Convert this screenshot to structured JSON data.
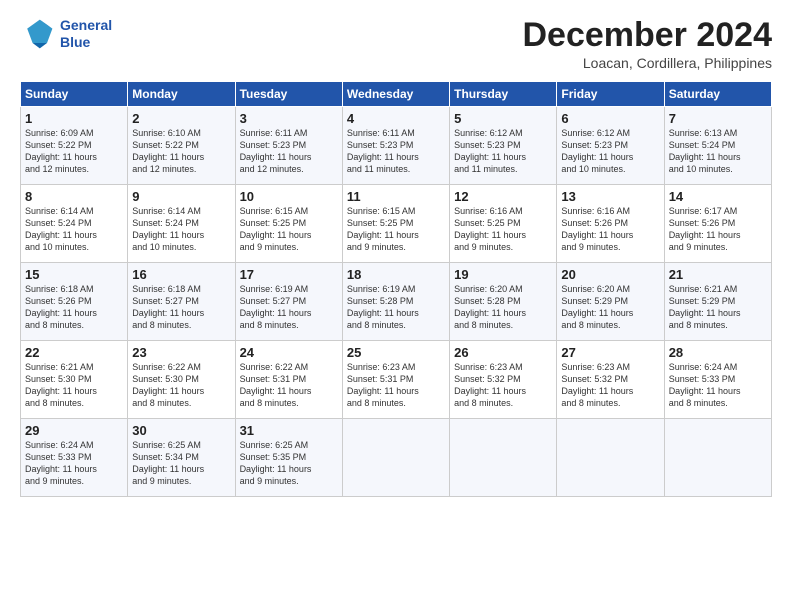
{
  "logo": {
    "text_general": "General",
    "text_blue": "Blue"
  },
  "title": "December 2024",
  "location": "Loacan, Cordillera, Philippines",
  "days_of_week": [
    "Sunday",
    "Monday",
    "Tuesday",
    "Wednesday",
    "Thursday",
    "Friday",
    "Saturday"
  ],
  "weeks": [
    [
      {
        "day": "1",
        "lines": [
          "Sunrise: 6:09 AM",
          "Sunset: 5:22 PM",
          "Daylight: 11 hours",
          "and 12 minutes."
        ]
      },
      {
        "day": "2",
        "lines": [
          "Sunrise: 6:10 AM",
          "Sunset: 5:22 PM",
          "Daylight: 11 hours",
          "and 12 minutes."
        ]
      },
      {
        "day": "3",
        "lines": [
          "Sunrise: 6:11 AM",
          "Sunset: 5:23 PM",
          "Daylight: 11 hours",
          "and 12 minutes."
        ]
      },
      {
        "day": "4",
        "lines": [
          "Sunrise: 6:11 AM",
          "Sunset: 5:23 PM",
          "Daylight: 11 hours",
          "and 11 minutes."
        ]
      },
      {
        "day": "5",
        "lines": [
          "Sunrise: 6:12 AM",
          "Sunset: 5:23 PM",
          "Daylight: 11 hours",
          "and 11 minutes."
        ]
      },
      {
        "day": "6",
        "lines": [
          "Sunrise: 6:12 AM",
          "Sunset: 5:23 PM",
          "Daylight: 11 hours",
          "and 10 minutes."
        ]
      },
      {
        "day": "7",
        "lines": [
          "Sunrise: 6:13 AM",
          "Sunset: 5:24 PM",
          "Daylight: 11 hours",
          "and 10 minutes."
        ]
      }
    ],
    [
      {
        "day": "8",
        "lines": [
          "Sunrise: 6:14 AM",
          "Sunset: 5:24 PM",
          "Daylight: 11 hours",
          "and 10 minutes."
        ]
      },
      {
        "day": "9",
        "lines": [
          "Sunrise: 6:14 AM",
          "Sunset: 5:24 PM",
          "Daylight: 11 hours",
          "and 10 minutes."
        ]
      },
      {
        "day": "10",
        "lines": [
          "Sunrise: 6:15 AM",
          "Sunset: 5:25 PM",
          "Daylight: 11 hours",
          "and 9 minutes."
        ]
      },
      {
        "day": "11",
        "lines": [
          "Sunrise: 6:15 AM",
          "Sunset: 5:25 PM",
          "Daylight: 11 hours",
          "and 9 minutes."
        ]
      },
      {
        "day": "12",
        "lines": [
          "Sunrise: 6:16 AM",
          "Sunset: 5:25 PM",
          "Daylight: 11 hours",
          "and 9 minutes."
        ]
      },
      {
        "day": "13",
        "lines": [
          "Sunrise: 6:16 AM",
          "Sunset: 5:26 PM",
          "Daylight: 11 hours",
          "and 9 minutes."
        ]
      },
      {
        "day": "14",
        "lines": [
          "Sunrise: 6:17 AM",
          "Sunset: 5:26 PM",
          "Daylight: 11 hours",
          "and 9 minutes."
        ]
      }
    ],
    [
      {
        "day": "15",
        "lines": [
          "Sunrise: 6:18 AM",
          "Sunset: 5:26 PM",
          "Daylight: 11 hours",
          "and 8 minutes."
        ]
      },
      {
        "day": "16",
        "lines": [
          "Sunrise: 6:18 AM",
          "Sunset: 5:27 PM",
          "Daylight: 11 hours",
          "and 8 minutes."
        ]
      },
      {
        "day": "17",
        "lines": [
          "Sunrise: 6:19 AM",
          "Sunset: 5:27 PM",
          "Daylight: 11 hours",
          "and 8 minutes."
        ]
      },
      {
        "day": "18",
        "lines": [
          "Sunrise: 6:19 AM",
          "Sunset: 5:28 PM",
          "Daylight: 11 hours",
          "and 8 minutes."
        ]
      },
      {
        "day": "19",
        "lines": [
          "Sunrise: 6:20 AM",
          "Sunset: 5:28 PM",
          "Daylight: 11 hours",
          "and 8 minutes."
        ]
      },
      {
        "day": "20",
        "lines": [
          "Sunrise: 6:20 AM",
          "Sunset: 5:29 PM",
          "Daylight: 11 hours",
          "and 8 minutes."
        ]
      },
      {
        "day": "21",
        "lines": [
          "Sunrise: 6:21 AM",
          "Sunset: 5:29 PM",
          "Daylight: 11 hours",
          "and 8 minutes."
        ]
      }
    ],
    [
      {
        "day": "22",
        "lines": [
          "Sunrise: 6:21 AM",
          "Sunset: 5:30 PM",
          "Daylight: 11 hours",
          "and 8 minutes."
        ]
      },
      {
        "day": "23",
        "lines": [
          "Sunrise: 6:22 AM",
          "Sunset: 5:30 PM",
          "Daylight: 11 hours",
          "and 8 minutes."
        ]
      },
      {
        "day": "24",
        "lines": [
          "Sunrise: 6:22 AM",
          "Sunset: 5:31 PM",
          "Daylight: 11 hours",
          "and 8 minutes."
        ]
      },
      {
        "day": "25",
        "lines": [
          "Sunrise: 6:23 AM",
          "Sunset: 5:31 PM",
          "Daylight: 11 hours",
          "and 8 minutes."
        ]
      },
      {
        "day": "26",
        "lines": [
          "Sunrise: 6:23 AM",
          "Sunset: 5:32 PM",
          "Daylight: 11 hours",
          "and 8 minutes."
        ]
      },
      {
        "day": "27",
        "lines": [
          "Sunrise: 6:23 AM",
          "Sunset: 5:32 PM",
          "Daylight: 11 hours",
          "and 8 minutes."
        ]
      },
      {
        "day": "28",
        "lines": [
          "Sunrise: 6:24 AM",
          "Sunset: 5:33 PM",
          "Daylight: 11 hours",
          "and 8 minutes."
        ]
      }
    ],
    [
      {
        "day": "29",
        "lines": [
          "Sunrise: 6:24 AM",
          "Sunset: 5:33 PM",
          "Daylight: 11 hours",
          "and 9 minutes."
        ]
      },
      {
        "day": "30",
        "lines": [
          "Sunrise: 6:25 AM",
          "Sunset: 5:34 PM",
          "Daylight: 11 hours",
          "and 9 minutes."
        ]
      },
      {
        "day": "31",
        "lines": [
          "Sunrise: 6:25 AM",
          "Sunset: 5:35 PM",
          "Daylight: 11 hours",
          "and 9 minutes."
        ]
      },
      null,
      null,
      null,
      null
    ]
  ]
}
